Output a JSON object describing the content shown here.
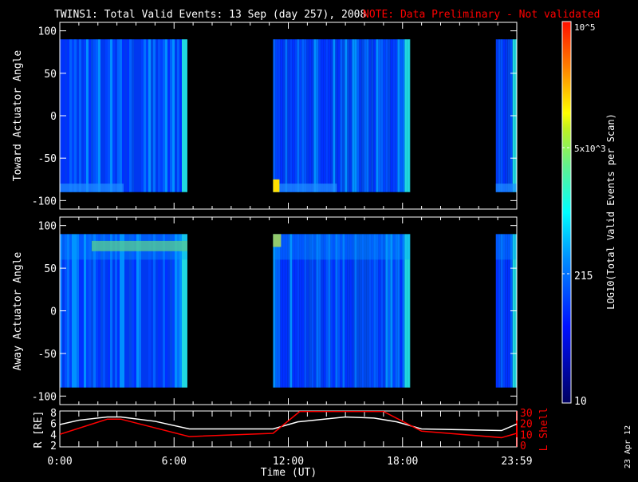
{
  "title": {
    "main": "TWINS1: Total Valid Events: 13 Sep (day 257), 2008",
    "note": "NOTE: Data Preliminary - Not validated"
  },
  "footer_date": "23 Apr 12",
  "colors": {
    "note": "#ff0000",
    "lshell": "#ff0000",
    "radius": "#ffffff"
  },
  "chart_data": [
    {
      "type": "heatmap",
      "ylabel": "Toward Actuator Angle",
      "ylim": [
        -110,
        110
      ],
      "yticks": [
        "100",
        "50",
        "0",
        "-50",
        "-100"
      ],
      "data_y_range": [
        -90,
        90
      ],
      "data_intervals_hours": [
        [
          0,
          6.7
        ],
        [
          11.2,
          18.4
        ],
        [
          22.9,
          24
        ]
      ]
    },
    {
      "type": "heatmap",
      "ylabel": "Away Actuator Angle",
      "ylim": [
        -110,
        110
      ],
      "yticks": [
        "100",
        "50",
        "0",
        "-50",
        "-100"
      ],
      "data_y_range": [
        -90,
        90
      ],
      "data_intervals_hours": [
        [
          0,
          6.7
        ],
        [
          11.2,
          18.4
        ],
        [
          22.9,
          24
        ]
      ]
    },
    {
      "type": "line",
      "xlabel": "Time (UT)",
      "xticks": [
        "0:00",
        "6:00",
        "12:00",
        "18:00",
        "23:59"
      ],
      "ylabel_left": "R [RE]",
      "ylabel_right": "L Shell",
      "yticks_left": [
        "8",
        "6",
        "4",
        "2"
      ],
      "yticks_right": [
        "30",
        "20",
        "10",
        "0"
      ],
      "ylim_left": [
        2,
        8
      ],
      "ylim_right": [
        0,
        30
      ],
      "series": [
        {
          "name": "R",
          "axis": "left",
          "x": [
            0,
            1,
            2.5,
            3.2,
            5,
            6.8,
            11.2,
            12.5,
            15,
            16.5,
            17.7,
            19,
            23.2,
            24
          ],
          "y": [
            5.8,
            6.6,
            7.2,
            7.2,
            6.4,
            5.0,
            5.0,
            6.3,
            7.2,
            7.0,
            6.3,
            5.0,
            4.7,
            5.9
          ]
        },
        {
          "name": "L Shell",
          "axis": "right",
          "x": [
            0,
            2.5,
            3.2,
            6.8,
            11.2,
            12.6,
            17.0,
            19,
            23.2,
            24
          ],
          "y": [
            10,
            24,
            24,
            8,
            11,
            31,
            31,
            13,
            7,
            11
          ]
        }
      ]
    }
  ],
  "colorbar": {
    "label": "LOG10(Total Valid Events per Scan)",
    "ticks": [
      {
        "label": "10",
        "value": 10
      },
      {
        "label": "215",
        "value": 215
      },
      {
        "label": "5x10^3",
        "value": 5000
      },
      {
        "label": "10^5",
        "value": 100000
      }
    ]
  }
}
